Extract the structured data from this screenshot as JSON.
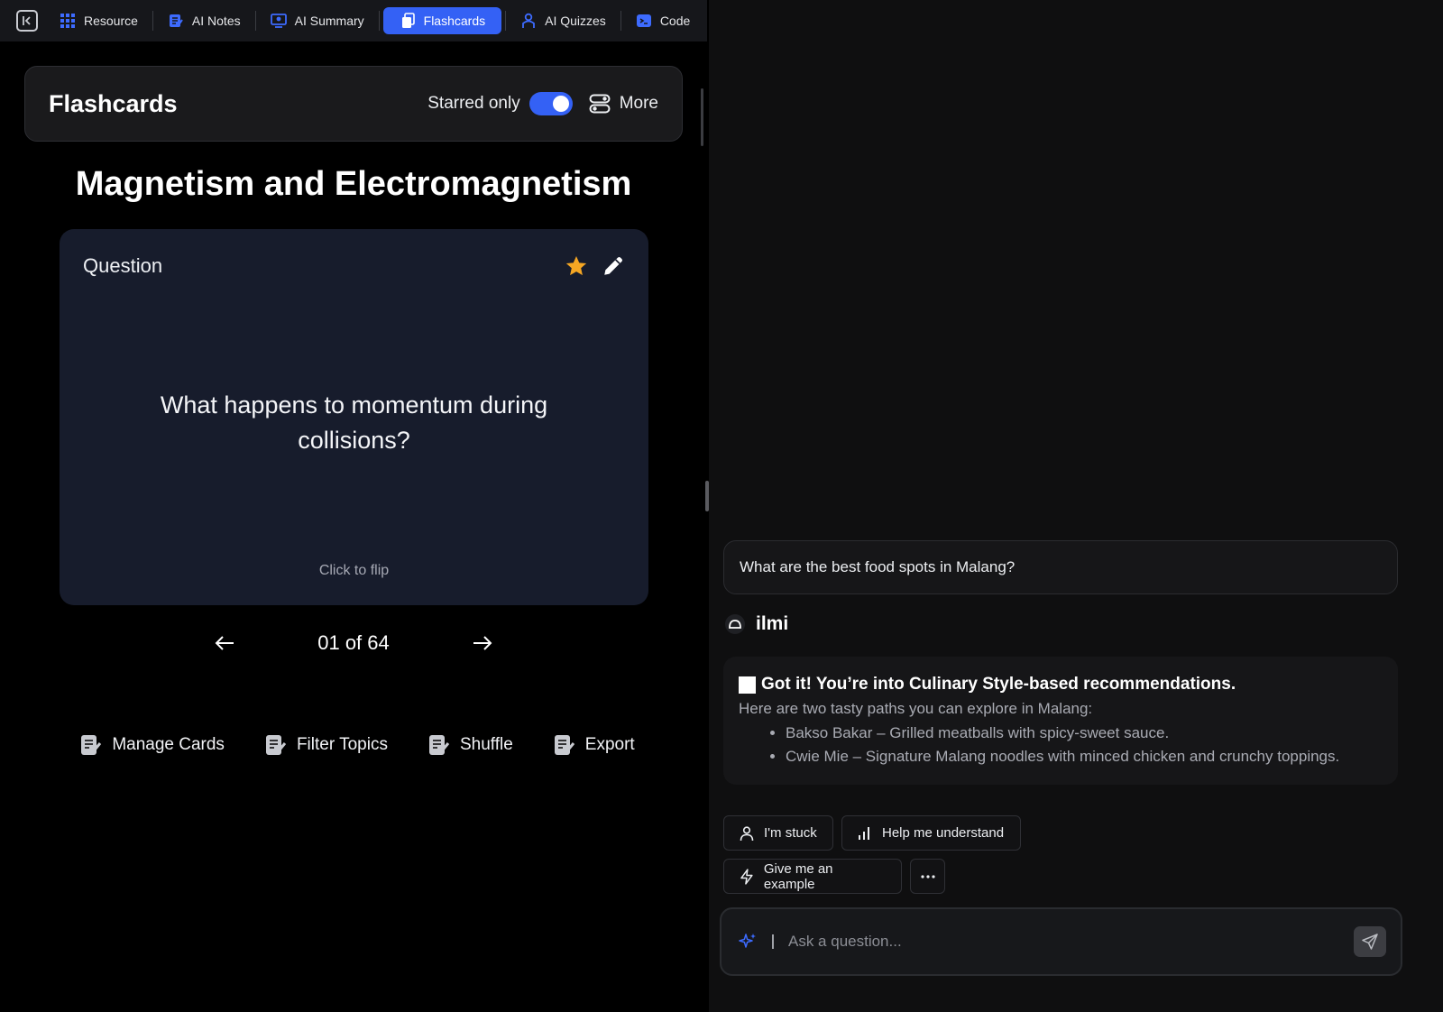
{
  "nav": {
    "tabs": [
      {
        "label": "Resource",
        "icon": "grid-icon"
      },
      {
        "label": "AI Notes",
        "icon": "notes-icon"
      },
      {
        "label": "AI Summary",
        "icon": "summary-icon"
      },
      {
        "label": "Flashcards",
        "icon": "flashcards-icon",
        "active": true
      },
      {
        "label": "AI Quizzes",
        "icon": "quiz-icon"
      },
      {
        "label": "Code",
        "icon": "code-icon"
      }
    ]
  },
  "flashcards": {
    "title": "Flashcards",
    "starred_label": "Starred only",
    "more_label": "More",
    "topic": "Magnetism and Electromagnetism",
    "card": {
      "label": "Question",
      "question": "What happens to momentum during collisions?",
      "flip_hint": "Click to flip"
    },
    "pager": "01 of 64",
    "actions": [
      {
        "label": "Manage Cards"
      },
      {
        "label": "Filter Topics"
      },
      {
        "label": "Shuffle"
      },
      {
        "label": "Export"
      }
    ]
  },
  "chat": {
    "user_message": "What are the best food spots in Malang?",
    "bot_name": "ilmi",
    "bot_reply": {
      "title": "Got it! You’re into Culinary Style-based recommendations.",
      "intro": "Here are two tasty paths you can explore in Malang:",
      "items": [
        "Bakso Bakar – Grilled meatballs with spicy-sweet sauce.",
        "Cwie Mie – Signature Malang noodles with minced chicken and crunchy toppings."
      ]
    },
    "chips": {
      "stuck": "I'm stuck",
      "help": "Help me understand",
      "example": "Give me an example"
    },
    "input_placeholder": "Ask a question..."
  },
  "colors": {
    "accent": "#3461f5",
    "star": "#f5a623",
    "card_bg": "#171c2c"
  }
}
